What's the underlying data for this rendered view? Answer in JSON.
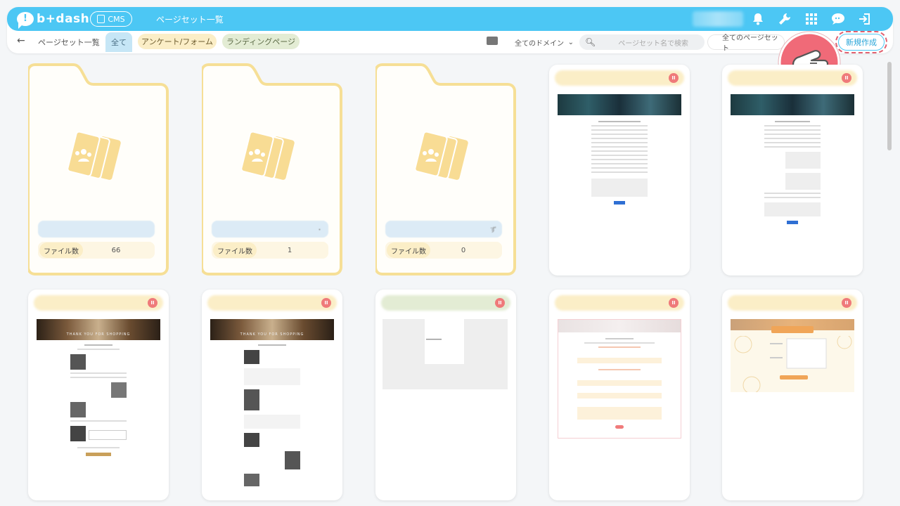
{
  "header": {
    "logo_mark": "!",
    "logo_text": "b+dash",
    "cms_label": "CMS",
    "title": "ページセット一覧",
    "icons": [
      "bell-icon",
      "wrench-icon",
      "grid-icon",
      "chat-icon",
      "logout-icon"
    ]
  },
  "toolbar": {
    "back_glyph": "←",
    "breadcrumb": "ページセット一覧",
    "tabs": {
      "all": "全て",
      "form": "アンケート/フォーム",
      "lp": "ランディングページ"
    },
    "domain_select": "全てのドメイン",
    "search_placeholder": "ページセット名で検索",
    "pageset_select": "全てのページセット",
    "new_button": "新規作成"
  },
  "folders": [
    {
      "name_suffix": "",
      "count_label": "ファイル数",
      "count": "66"
    },
    {
      "name_suffix": "・",
      "count_label": "ファイル数",
      "count": "1"
    },
    {
      "name_suffix": "ず",
      "count_label": "ファイル数",
      "count": "0"
    }
  ],
  "cards": {
    "shopping_banner": "THANK YOU FOR SHOPPING",
    "pause_glyph": "II"
  },
  "colors": {
    "accent": "#4cc7f4",
    "folder_border": "#f6df96",
    "folder_fill": "#fffefa",
    "highlight": "#e06070"
  }
}
